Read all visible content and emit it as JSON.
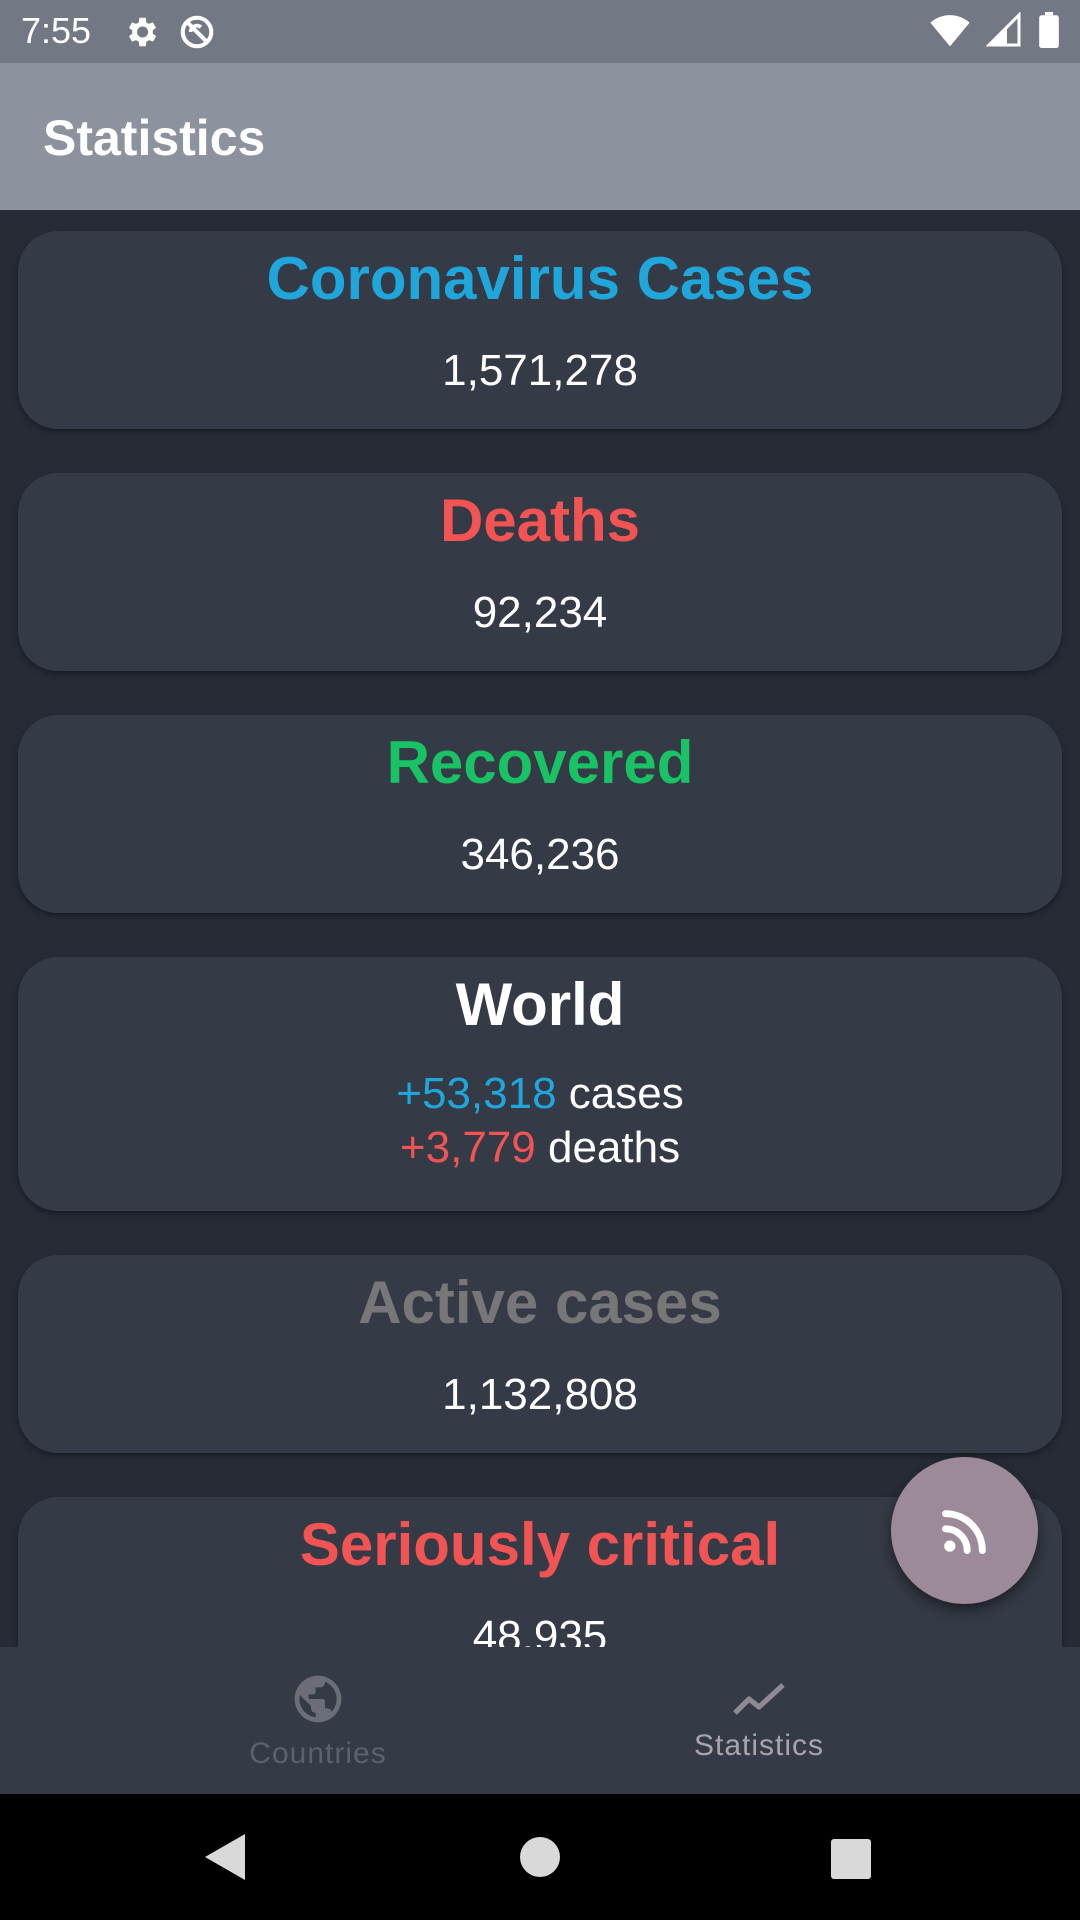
{
  "status_bar": {
    "time": "7:55",
    "icons": [
      "gear-icon",
      "no-sync-icon",
      "wifi-icon",
      "signal-icon",
      "battery-icon"
    ]
  },
  "app_bar": {
    "title": "Statistics"
  },
  "cards": {
    "cases": {
      "title": "Coronavirus Cases",
      "value": "1,571,278",
      "color": "#1fa7dc"
    },
    "deaths": {
      "title": "Deaths",
      "value": "92,234",
      "color": "#f25454"
    },
    "recovered": {
      "title": "Recovered",
      "value": "346,236",
      "color": "#19c265"
    },
    "world": {
      "title": "World",
      "new_cases": "+53,318",
      "cases_label": "cases",
      "new_deaths": "+3,779",
      "deaths_label": "deaths"
    },
    "active": {
      "title": "Active cases",
      "value": "1,132,808",
      "color": "#777777"
    },
    "critical": {
      "title": "Seriously critical",
      "value": "48,935",
      "color": "#f25454"
    }
  },
  "fab": {
    "icon": "rss-feed-icon",
    "color": "#9d8a98"
  },
  "bottom_nav": {
    "items": [
      {
        "label": "Countries",
        "icon": "globe-icon",
        "active": false
      },
      {
        "label": "Statistics",
        "icon": "trending-line-icon",
        "active": true
      }
    ]
  },
  "system_nav": {
    "icons": [
      "back-icon",
      "home-icon",
      "recents-icon"
    ]
  }
}
